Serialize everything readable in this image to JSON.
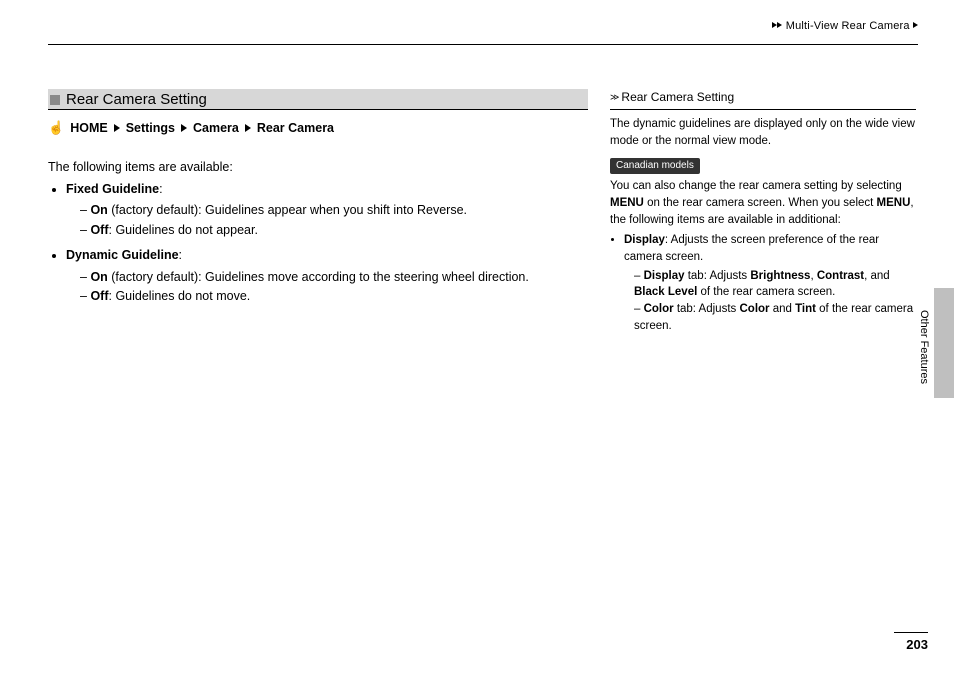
{
  "header": {
    "breadcrumb_pre": "Multi-View Rear Camera"
  },
  "section": {
    "title": "Rear Camera Setting",
    "nav": {
      "home": "HOME",
      "settings": "Settings",
      "camera": "Camera",
      "rear": "Rear Camera"
    },
    "intro": "The following items are available:",
    "items": [
      {
        "name": "Fixed Guideline",
        "on_label": "On",
        "on_note": " (factory default): Guidelines appear when you shift into Reverse.",
        "off_label": "Off",
        "off_note": ": Guidelines do not appear."
      },
      {
        "name": "Dynamic Guideline",
        "on_label": "On",
        "on_note": " (factory default): Guidelines move according to the steering wheel direction.",
        "off_label": "Off",
        "off_note": ": Guidelines do not move."
      }
    ]
  },
  "sidebar": {
    "ref_title": "Rear Camera Setting",
    "note1": "The dynamic guidelines are displayed only on the wide view mode or the normal view mode.",
    "badge": "Canadian models",
    "note2_pre": "You can also change the rear camera setting by selecting ",
    "menu": "MENU",
    "note2_mid": " on the rear camera screen. When you select ",
    "note2_post": ", the following items are available in additional:",
    "display": {
      "name": "Display",
      "desc": ": Adjusts the screen preference of the rear camera screen.",
      "tab1_name": "Display",
      "tab1_mid": " tab: Adjusts ",
      "brightness": "Brightness",
      "contrast": "Contrast",
      "and": ", and ",
      "black": "Black Level",
      "tab1_end": " of the rear camera screen.",
      "tab2_name": "Color",
      "tab2_mid": " tab: Adjusts ",
      "color": "Color",
      "and2": " and ",
      "tint": "Tint",
      "tab2_end": " of the rear camera screen."
    }
  },
  "tab_label": "Other Features",
  "page_number": "203"
}
